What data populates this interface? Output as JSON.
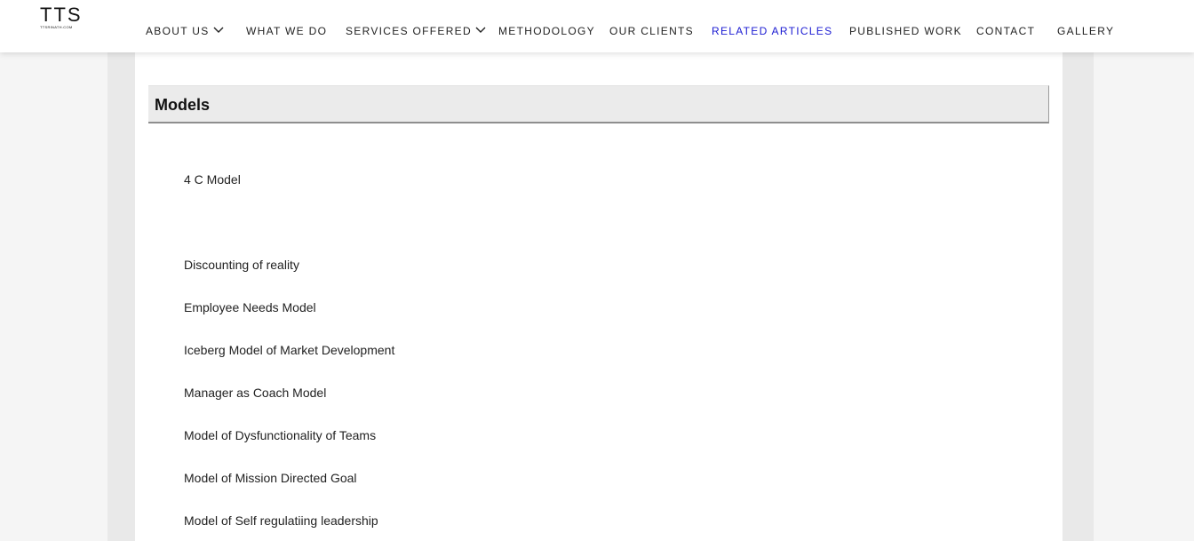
{
  "logo": {
    "main": "TTS",
    "sub": "TTSRINATH.COM"
  },
  "nav": {
    "items": [
      {
        "label": "ABOUT US",
        "dropdown": true
      },
      {
        "label": "WHAT WE DO",
        "dropdown": false
      },
      {
        "label": "SERVICES OFFERED",
        "dropdown": true
      },
      {
        "label": "METHODOLOGY",
        "dropdown": false
      },
      {
        "label": "OUR CLIENTS",
        "dropdown": false
      },
      {
        "label": "RELATED ARTICLES",
        "dropdown": false,
        "active": true
      },
      {
        "label": "PUBLISHED WORK",
        "dropdown": false
      },
      {
        "label": "CONTACT",
        "dropdown": false
      },
      {
        "label": "GALLERY",
        "dropdown": false
      }
    ],
    "active_color": "#1a1ad2"
  },
  "section": {
    "title": "Models"
  },
  "models": [
    "4 C Model",
    "Discounting of reality",
    "Employee Needs Model",
    "Iceberg Model of Market Development",
    "Manager as Coach Model",
    "Model of Dysfunctionality of Teams",
    "Model of Mission Directed Goal",
    "Model of Self regulatiing leadership"
  ],
  "icons": {
    "dropdown": "chevron-down-icon"
  }
}
